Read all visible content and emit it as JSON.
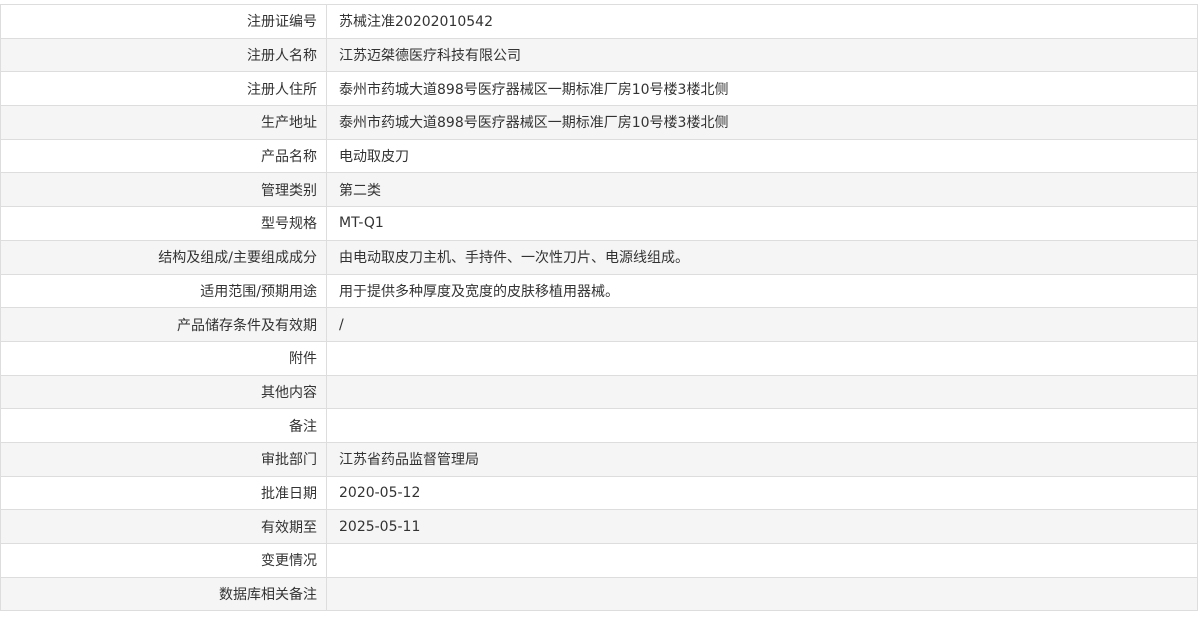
{
  "rows": [
    {
      "label": "注册证编号",
      "value": "苏械注准20202010542"
    },
    {
      "label": "注册人名称",
      "value": "江苏迈桀德医疗科技有限公司"
    },
    {
      "label": "注册人住所",
      "value": "泰州市药城大道898号医疗器械区一期标准厂房10号楼3楼北侧"
    },
    {
      "label": "生产地址",
      "value": "泰州市药城大道898号医疗器械区一期标准厂房10号楼3楼北侧"
    },
    {
      "label": "产品名称",
      "value": "电动取皮刀"
    },
    {
      "label": "管理类别",
      "value": "第二类"
    },
    {
      "label": "型号规格",
      "value": "MT-Q1"
    },
    {
      "label": "结构及组成/主要组成成分",
      "value": "由电动取皮刀主机、手持件、一次性刀片、电源线组成。"
    },
    {
      "label": "适用范围/预期用途",
      "value": "用于提供多种厚度及宽度的皮肤移植用器械。"
    },
    {
      "label": "产品储存条件及有效期",
      "value": "/"
    },
    {
      "label": "附件",
      "value": ""
    },
    {
      "label": "其他内容",
      "value": ""
    },
    {
      "label": "备注",
      "value": ""
    },
    {
      "label": "审批部门",
      "value": "江苏省药品监督管理局"
    },
    {
      "label": "批准日期",
      "value": "2020-05-12"
    },
    {
      "label": "有效期至",
      "value": "2025-05-11"
    },
    {
      "label": "变更情况",
      "value": ""
    },
    {
      "label": "数据库相关备注",
      "value": ""
    }
  ]
}
